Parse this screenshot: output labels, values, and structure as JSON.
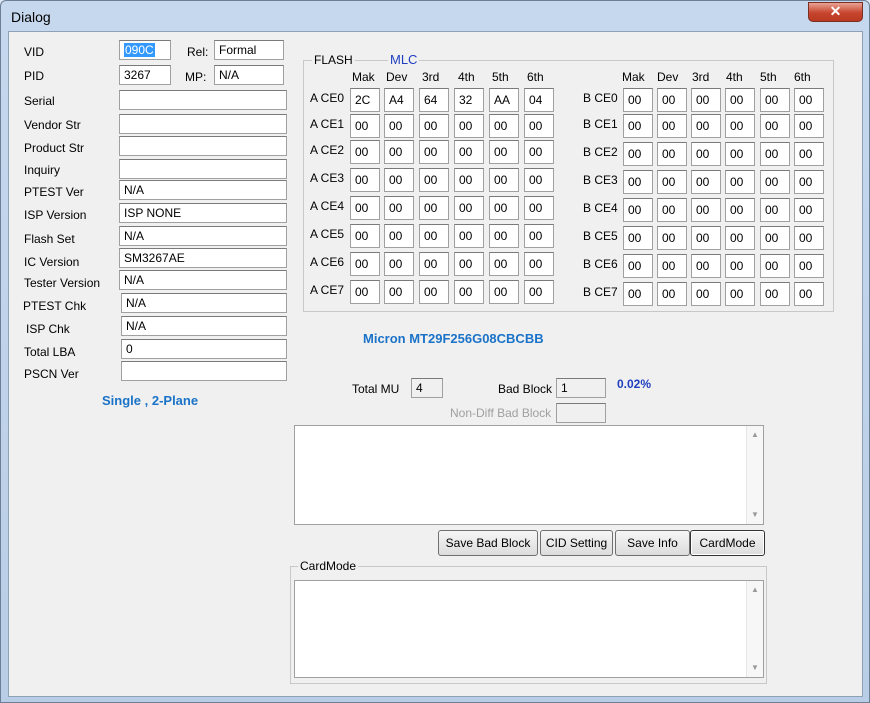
{
  "window": {
    "title": "Dialog",
    "close_glyph": "✕"
  },
  "left": {
    "vid_label": "VID",
    "vid_value": "090C",
    "rel_label": "Rel:",
    "rel_value": "Formal",
    "pid_label": "PID",
    "pid_value": "3267",
    "mp_label": "MP:",
    "mp_value": "N/A",
    "rows": [
      {
        "label": "Serial",
        "value": ""
      },
      {
        "label": "Vendor Str",
        "value": ""
      },
      {
        "label": "Product Str",
        "value": ""
      },
      {
        "label": "Inquiry",
        "value": ""
      },
      {
        "label": "PTEST Ver",
        "value": "N/A"
      },
      {
        "label": "ISP Version",
        "value": "ISP NONE"
      },
      {
        "label": "Flash Set",
        "value": "N/A"
      },
      {
        "label": "IC Version",
        "value": "SM3267AE"
      },
      {
        "label": "Tester Version",
        "value": "N/A"
      },
      {
        "label": "PTEST Chk",
        "value": "N/A"
      },
      {
        "label": "ISP Chk",
        "value": "N/A"
      },
      {
        "label": "Total LBA",
        "value": "0"
      },
      {
        "label": "PSCN Ver",
        "value": ""
      }
    ],
    "plane_text": "Single , 2-Plane"
  },
  "flash": {
    "group_label": "FLASH",
    "type_label": "MLC",
    "col_headers": [
      "Mak",
      "Dev",
      "3rd",
      "4th",
      "5th",
      "6th"
    ],
    "a_rows": [
      {
        "label": "A CE0",
        "values": [
          "2C",
          "A4",
          "64",
          "32",
          "AA",
          "04"
        ]
      },
      {
        "label": "A CE1",
        "values": [
          "00",
          "00",
          "00",
          "00",
          "00",
          "00"
        ]
      },
      {
        "label": "A CE2",
        "values": [
          "00",
          "00",
          "00",
          "00",
          "00",
          "00"
        ]
      },
      {
        "label": "A CE3",
        "values": [
          "00",
          "00",
          "00",
          "00",
          "00",
          "00"
        ]
      },
      {
        "label": "A CE4",
        "values": [
          "00",
          "00",
          "00",
          "00",
          "00",
          "00"
        ]
      },
      {
        "label": "A CE5",
        "values": [
          "00",
          "00",
          "00",
          "00",
          "00",
          "00"
        ]
      },
      {
        "label": "A CE6",
        "values": [
          "00",
          "00",
          "00",
          "00",
          "00",
          "00"
        ]
      },
      {
        "label": "A CE7",
        "values": [
          "00",
          "00",
          "00",
          "00",
          "00",
          "00"
        ]
      }
    ],
    "b_rows": [
      {
        "label": "B CE0",
        "values": [
          "00",
          "00",
          "00",
          "00",
          "00",
          "00"
        ]
      },
      {
        "label": "B CE1",
        "values": [
          "00",
          "00",
          "00",
          "00",
          "00",
          "00"
        ]
      },
      {
        "label": "B CE2",
        "values": [
          "00",
          "00",
          "00",
          "00",
          "00",
          "00"
        ]
      },
      {
        "label": "B CE3",
        "values": [
          "00",
          "00",
          "00",
          "00",
          "00",
          "00"
        ]
      },
      {
        "label": "B CE4",
        "values": [
          "00",
          "00",
          "00",
          "00",
          "00",
          "00"
        ]
      },
      {
        "label": "B CE5",
        "values": [
          "00",
          "00",
          "00",
          "00",
          "00",
          "00"
        ]
      },
      {
        "label": "B CE6",
        "values": [
          "00",
          "00",
          "00",
          "00",
          "00",
          "00"
        ]
      },
      {
        "label": "B CE7",
        "values": [
          "00",
          "00",
          "00",
          "00",
          "00",
          "00"
        ]
      }
    ],
    "part_number": "Micron MT29F256G08CBCBB"
  },
  "stats": {
    "total_mu_label": "Total MU",
    "total_mu_value": "4",
    "bad_block_label": "Bad Block",
    "bad_block_value": "1",
    "bad_pct": "0.02%",
    "nondiff_label": "Non-Diff Bad Block",
    "nondiff_value": ""
  },
  "buttons": {
    "save_bad_block": "Save Bad Block",
    "cid_setting": "CID Setting",
    "save_info": "Save Info",
    "card_mode": "CardMode"
  },
  "cardmode_group": {
    "label": "CardMode"
  },
  "scroll": {
    "up_glyph": "▲",
    "down_glyph": "▼"
  },
  "colors": {
    "accent_text": "#1a73c8",
    "mlc_text": "#1f3fbf",
    "pct_text": "#1f3fbf"
  }
}
